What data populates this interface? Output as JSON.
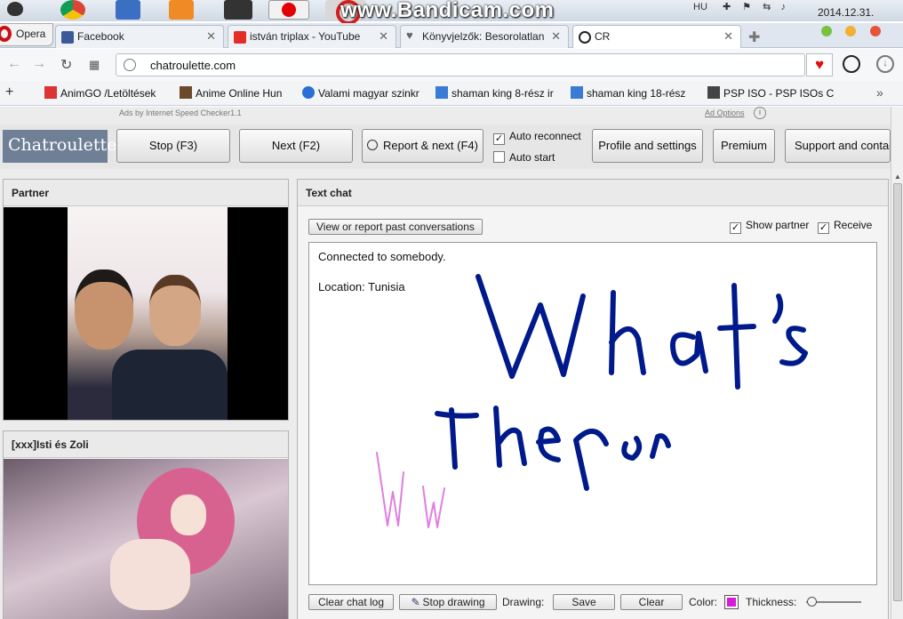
{
  "watermark": "www.Bandicam.com",
  "taskbar": {
    "tray_lang": "HU",
    "date": "2014.12.31."
  },
  "opera_label": "Opera",
  "tabs": [
    {
      "label": "Facebook",
      "color": "#3b5998"
    },
    {
      "label": "istván triplax - YouTube",
      "color": "#e52d27"
    },
    {
      "label": "Könyvjelzők: Besorolatlan",
      "color": "#666666"
    },
    {
      "label": "CR",
      "color": "#222222"
    }
  ],
  "url": "chatroulette.com",
  "bookmarks": [
    {
      "label": "AnimGO /Letöltések",
      "color": "#d33"
    },
    {
      "label": "Anime Online Hun",
      "color": "#6a4a2a"
    },
    {
      "label": "Valami magyar szinkr",
      "color": "#2a6fd6"
    },
    {
      "label": "shaman king 8-rész ir",
      "color": "#3a7bd5"
    },
    {
      "label": "shaman king 18-rész",
      "color": "#3a7bd5"
    },
    {
      "label": "PSP ISO - PSP ISOs C",
      "color": "#444"
    }
  ],
  "ads": {
    "text": "Ads by Internet Speed Checker1.1",
    "options": "Ad Options"
  },
  "toolbar": {
    "logo": "Chatroulette",
    "stop": "Stop (F3)",
    "next": "Next (F2)",
    "report": "Report & next (F4)",
    "auto_reconnect": "Auto reconnect",
    "auto_start": "Auto start",
    "profile": "Profile and settings",
    "premium": "Premium",
    "support": "Support and contact"
  },
  "partner": {
    "title": "Partner"
  },
  "self_panel": {
    "title": "[xxx]Isti  és Zoli"
  },
  "chat": {
    "title": "Text chat",
    "past": "View or report past conversations",
    "show_partner": "Show partner",
    "receive": "Receive",
    "messages": [
      "Connected to somebody.",
      "Location: Tunisia"
    ],
    "drawing_colors": {
      "partner": "#001a8c",
      "self": "#e07ee0"
    }
  },
  "bottom": {
    "clear_log": "Clear chat log",
    "stop_drawing": "Stop drawing",
    "drawing_label": "Drawing:",
    "save": "Save",
    "clear": "Clear",
    "color_label": "Color:",
    "thickness_label": "Thickness:",
    "thickness_level": 0.05
  },
  "colors": {
    "accent": "#6e7f96",
    "draw_color": "#d91ad9"
  }
}
